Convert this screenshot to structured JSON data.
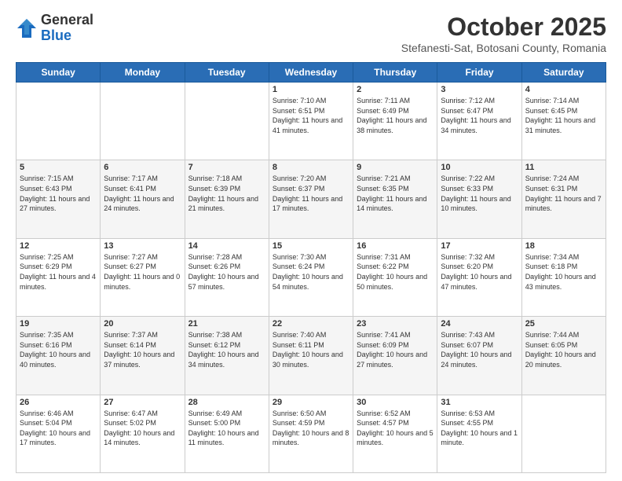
{
  "header": {
    "logo_general": "General",
    "logo_blue": "Blue",
    "month_title": "October 2025",
    "location": "Stefanesti-Sat, Botosani County, Romania"
  },
  "weekdays": [
    "Sunday",
    "Monday",
    "Tuesday",
    "Wednesday",
    "Thursday",
    "Friday",
    "Saturday"
  ],
  "weeks": [
    [
      {
        "day": "",
        "info": ""
      },
      {
        "day": "",
        "info": ""
      },
      {
        "day": "",
        "info": ""
      },
      {
        "day": "1",
        "info": "Sunrise: 7:10 AM\nSunset: 6:51 PM\nDaylight: 11 hours and 41 minutes."
      },
      {
        "day": "2",
        "info": "Sunrise: 7:11 AM\nSunset: 6:49 PM\nDaylight: 11 hours and 38 minutes."
      },
      {
        "day": "3",
        "info": "Sunrise: 7:12 AM\nSunset: 6:47 PM\nDaylight: 11 hours and 34 minutes."
      },
      {
        "day": "4",
        "info": "Sunrise: 7:14 AM\nSunset: 6:45 PM\nDaylight: 11 hours and 31 minutes."
      }
    ],
    [
      {
        "day": "5",
        "info": "Sunrise: 7:15 AM\nSunset: 6:43 PM\nDaylight: 11 hours and 27 minutes."
      },
      {
        "day": "6",
        "info": "Sunrise: 7:17 AM\nSunset: 6:41 PM\nDaylight: 11 hours and 24 minutes."
      },
      {
        "day": "7",
        "info": "Sunrise: 7:18 AM\nSunset: 6:39 PM\nDaylight: 11 hours and 21 minutes."
      },
      {
        "day": "8",
        "info": "Sunrise: 7:20 AM\nSunset: 6:37 PM\nDaylight: 11 hours and 17 minutes."
      },
      {
        "day": "9",
        "info": "Sunrise: 7:21 AM\nSunset: 6:35 PM\nDaylight: 11 hours and 14 minutes."
      },
      {
        "day": "10",
        "info": "Sunrise: 7:22 AM\nSunset: 6:33 PM\nDaylight: 11 hours and 10 minutes."
      },
      {
        "day": "11",
        "info": "Sunrise: 7:24 AM\nSunset: 6:31 PM\nDaylight: 11 hours and 7 minutes."
      }
    ],
    [
      {
        "day": "12",
        "info": "Sunrise: 7:25 AM\nSunset: 6:29 PM\nDaylight: 11 hours and 4 minutes."
      },
      {
        "day": "13",
        "info": "Sunrise: 7:27 AM\nSunset: 6:27 PM\nDaylight: 11 hours and 0 minutes."
      },
      {
        "day": "14",
        "info": "Sunrise: 7:28 AM\nSunset: 6:26 PM\nDaylight: 10 hours and 57 minutes."
      },
      {
        "day": "15",
        "info": "Sunrise: 7:30 AM\nSunset: 6:24 PM\nDaylight: 10 hours and 54 minutes."
      },
      {
        "day": "16",
        "info": "Sunrise: 7:31 AM\nSunset: 6:22 PM\nDaylight: 10 hours and 50 minutes."
      },
      {
        "day": "17",
        "info": "Sunrise: 7:32 AM\nSunset: 6:20 PM\nDaylight: 10 hours and 47 minutes."
      },
      {
        "day": "18",
        "info": "Sunrise: 7:34 AM\nSunset: 6:18 PM\nDaylight: 10 hours and 43 minutes."
      }
    ],
    [
      {
        "day": "19",
        "info": "Sunrise: 7:35 AM\nSunset: 6:16 PM\nDaylight: 10 hours and 40 minutes."
      },
      {
        "day": "20",
        "info": "Sunrise: 7:37 AM\nSunset: 6:14 PM\nDaylight: 10 hours and 37 minutes."
      },
      {
        "day": "21",
        "info": "Sunrise: 7:38 AM\nSunset: 6:12 PM\nDaylight: 10 hours and 34 minutes."
      },
      {
        "day": "22",
        "info": "Sunrise: 7:40 AM\nSunset: 6:11 PM\nDaylight: 10 hours and 30 minutes."
      },
      {
        "day": "23",
        "info": "Sunrise: 7:41 AM\nSunset: 6:09 PM\nDaylight: 10 hours and 27 minutes."
      },
      {
        "day": "24",
        "info": "Sunrise: 7:43 AM\nSunset: 6:07 PM\nDaylight: 10 hours and 24 minutes."
      },
      {
        "day": "25",
        "info": "Sunrise: 7:44 AM\nSunset: 6:05 PM\nDaylight: 10 hours and 20 minutes."
      }
    ],
    [
      {
        "day": "26",
        "info": "Sunrise: 6:46 AM\nSunset: 5:04 PM\nDaylight: 10 hours and 17 minutes."
      },
      {
        "day": "27",
        "info": "Sunrise: 6:47 AM\nSunset: 5:02 PM\nDaylight: 10 hours and 14 minutes."
      },
      {
        "day": "28",
        "info": "Sunrise: 6:49 AM\nSunset: 5:00 PM\nDaylight: 10 hours and 11 minutes."
      },
      {
        "day": "29",
        "info": "Sunrise: 6:50 AM\nSunset: 4:59 PM\nDaylight: 10 hours and 8 minutes."
      },
      {
        "day": "30",
        "info": "Sunrise: 6:52 AM\nSunset: 4:57 PM\nDaylight: 10 hours and 5 minutes."
      },
      {
        "day": "31",
        "info": "Sunrise: 6:53 AM\nSunset: 4:55 PM\nDaylight: 10 hours and 1 minute."
      },
      {
        "day": "",
        "info": ""
      }
    ]
  ]
}
